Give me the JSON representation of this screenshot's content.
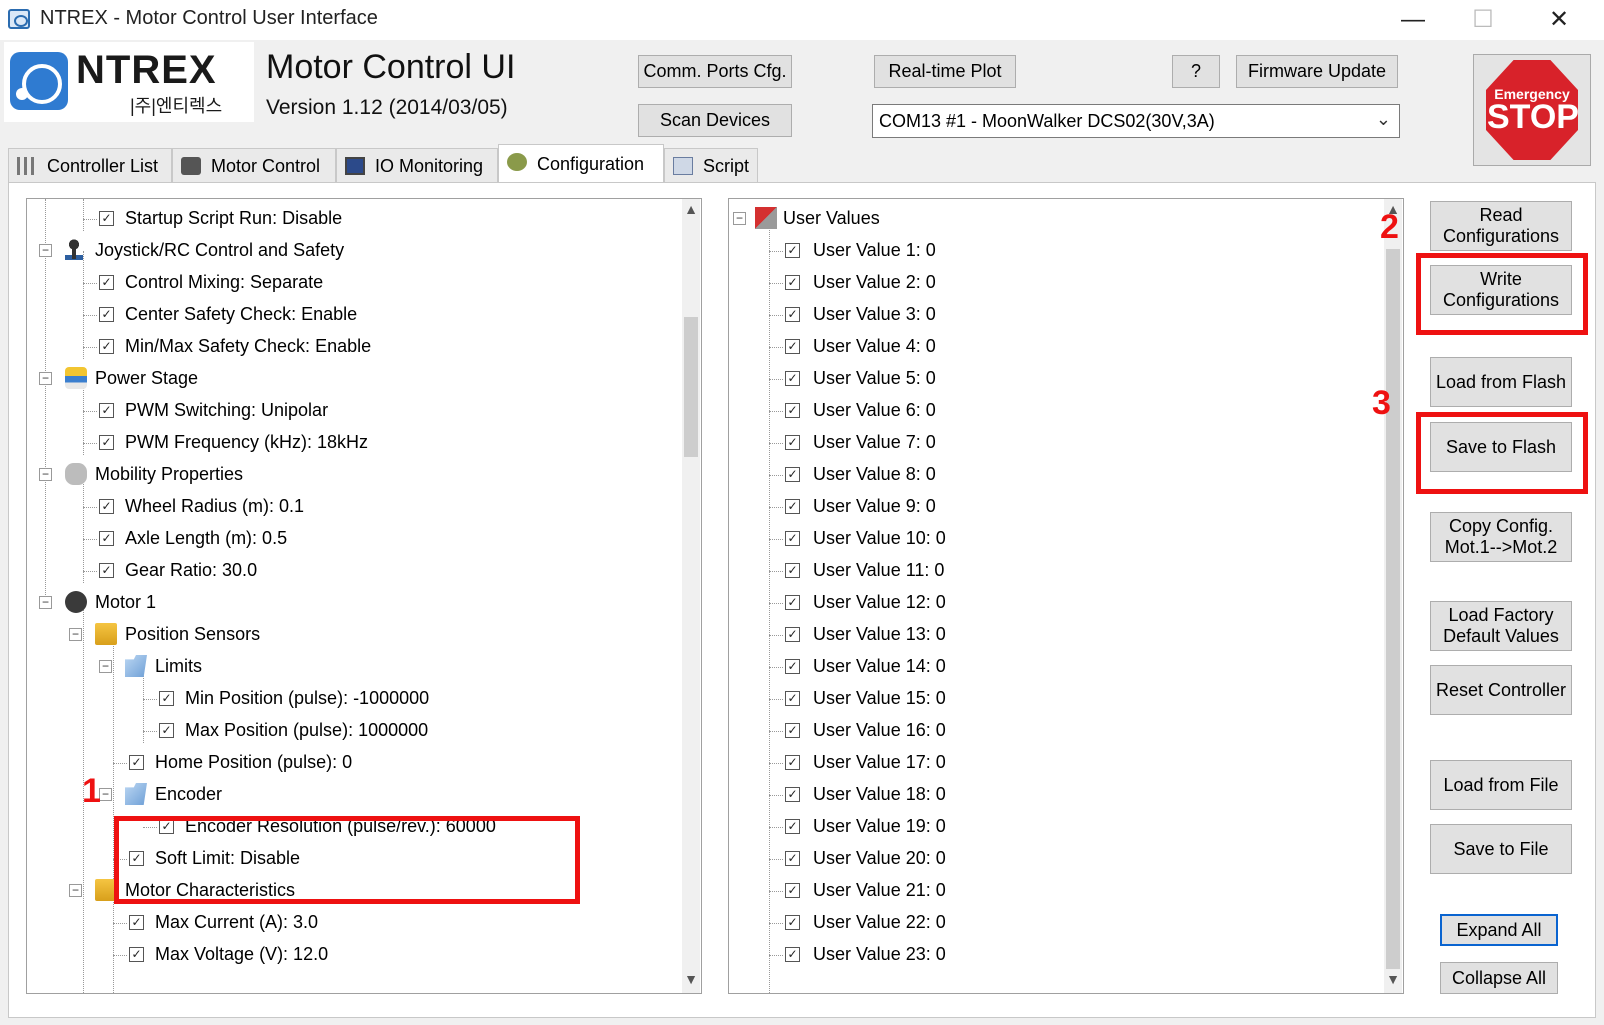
{
  "window": {
    "title": "NTREX - Motor Control User Interface",
    "minimize": "—",
    "maximize": "☐",
    "close": "✕"
  },
  "header": {
    "logo_text": "NTREX",
    "logo_sub": "|주|엔티렉스",
    "app_name": "Motor Control UI",
    "version": "Version 1.12 (2014/03/05)",
    "buttons": {
      "comm_ports": "Comm. Ports Cfg.",
      "scan_devices": "Scan Devices",
      "realtime_plot": "Real-time Plot",
      "help": "?",
      "firmware_update": "Firmware Update"
    },
    "port_select": {
      "value": "COM13 #1 - MoonWalker DCS02(30V,3A)",
      "icon": "chevron-down-icon"
    },
    "emergency_stop": {
      "top": "Emergency",
      "main": "STOP"
    }
  },
  "tabs": [
    {
      "label": "Controller List",
      "icon": "list-bars-icon"
    },
    {
      "label": "Motor Control",
      "icon": "motor-icon"
    },
    {
      "label": "IO Monitoring",
      "icon": "monitor-icon"
    },
    {
      "label": "Configuration",
      "icon": "gear-icon",
      "active": true
    },
    {
      "label": "Script",
      "icon": "script-icon"
    }
  ],
  "left_tree": {
    "startup_script": "Startup Script Run: Disable",
    "joystick": "Joystick/RC Control and Safety",
    "control_mixing": "Control Mixing: Separate",
    "center_safety": "Center Safety Check: Enable",
    "minmax_safety": "Min/Max Safety Check: Enable",
    "power_stage": "Power Stage",
    "pwm_switching": "PWM Switching: Unipolar",
    "pwm_frequency": "PWM Frequency (kHz): 18kHz",
    "mobility": "Mobility Properties",
    "wheel_radius": "Wheel Radius (m): 0.1",
    "axle_length": "Axle Length (m): 0.5",
    "gear_ratio": "Gear Ratio: 30.0",
    "motor1": "Motor 1",
    "position_sensors": "Position Sensors",
    "limits": "Limits",
    "min_position": "Min Position (pulse): -1000000",
    "max_position": "Max Position (pulse): 1000000",
    "home_position": "Home Position (pulse): 0",
    "encoder": "Encoder",
    "encoder_resolution": "Encoder Resolution (pulse/rev.): 60000",
    "soft_limit": "Soft Limit: Disable",
    "motor_characteristics": "Motor Characteristics",
    "max_current": "Max Current (A): 3.0",
    "max_voltage": "Max Voltage (V): 12.0"
  },
  "right_tree": {
    "root": "User Values",
    "items": [
      "User Value 1: 0",
      "User Value 2: 0",
      "User Value 3: 0",
      "User Value 4: 0",
      "User Value 5: 0",
      "User Value 6: 0",
      "User Value 7: 0",
      "User Value 8: 0",
      "User Value 9: 0",
      "User Value 10: 0",
      "User Value 11: 0",
      "User Value 12: 0",
      "User Value 13: 0",
      "User Value 14: 0",
      "User Value 15: 0",
      "User Value 16: 0",
      "User Value 17: 0",
      "User Value 18: 0",
      "User Value 19: 0",
      "User Value 20: 0",
      "User Value 21: 0",
      "User Value 22: 0",
      "User Value 23: 0"
    ]
  },
  "side_buttons": {
    "read": "Read\nConfigurations",
    "write": "Write\nConfigurations",
    "load_flash": "Load from Flash",
    "save_flash": "Save to Flash",
    "copy_config": "Copy Config.\nMot.1-->Mot.2",
    "factory": "Load Factory\nDefault Values",
    "reset": "Reset Controller",
    "load_file": "Load from File",
    "save_file": "Save to File",
    "expand_all": "Expand All",
    "collapse_all": "Collapse All"
  },
  "annotations": {
    "marker1": "1",
    "marker2": "2",
    "marker3": "3",
    "color": "#ee1111"
  },
  "scrollbars": {
    "up": "▲",
    "down": "▼"
  }
}
